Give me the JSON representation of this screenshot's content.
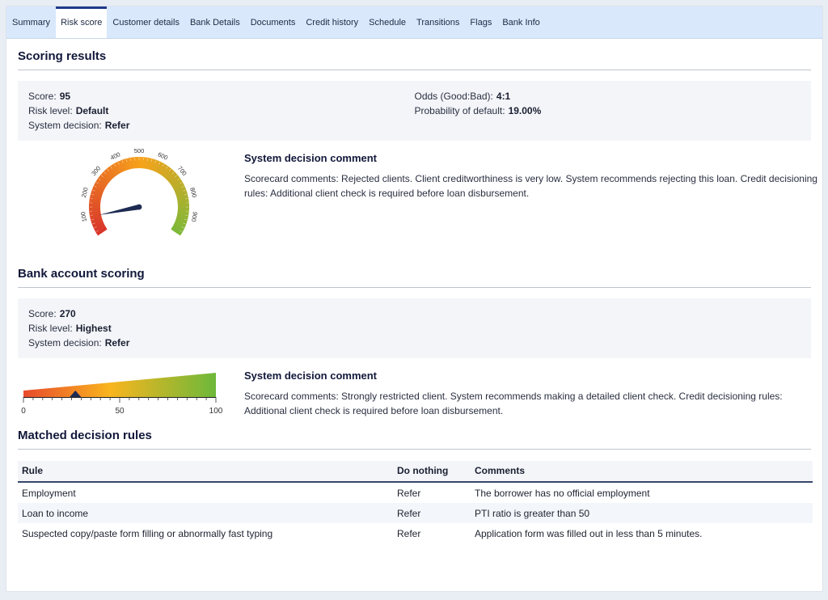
{
  "tabs": [
    {
      "label": "Summary",
      "active": false
    },
    {
      "label": "Risk score",
      "active": true
    },
    {
      "label": "Customer details",
      "active": false
    },
    {
      "label": "Bank Details",
      "active": false
    },
    {
      "label": "Documents",
      "active": false
    },
    {
      "label": "Credit history",
      "active": false
    },
    {
      "label": "Schedule",
      "active": false
    },
    {
      "label": "Transitions",
      "active": false
    },
    {
      "label": "Flags",
      "active": false
    },
    {
      "label": "Bank Info",
      "active": false
    }
  ],
  "scoring": {
    "title": "Scoring results",
    "score_label": "Score:",
    "score": "95",
    "risk_label": "Risk level:",
    "risk": "Default",
    "decision_label": "System decision:",
    "decision": "Refer",
    "odds_label": "Odds (Good:Bad):",
    "odds": "4:1",
    "pd_label": "Probability of default:",
    "pd": "19.00%",
    "gauge": {
      "min": 0,
      "max": 1000,
      "value": 95,
      "tick_labels": [
        "100",
        "200",
        "300",
        "400",
        "500",
        "600",
        "700",
        "800",
        "900"
      ],
      "colors": {
        "low": "#d9362b",
        "mid": "#f7a21b",
        "high": "#7ab93a",
        "needle": "#1d2a52"
      }
    },
    "comment_title": "System decision comment",
    "comment_text": "Scorecard comments: Rejected clients. Client creditworthiness is very low. System recommends rejecting this loan. Credit decisioning rules: Additional client check is required before loan disbursement."
  },
  "bank": {
    "title": "Bank account scoring",
    "score_label": "Score:",
    "score": "270",
    "risk_label": "Risk level:",
    "risk": "Highest",
    "decision_label": "System decision:",
    "decision": "Refer",
    "scale": {
      "min": 0,
      "max": 100,
      "marker": 27,
      "tick_labels": [
        "0",
        "50",
        "100"
      ],
      "colors": {
        "low": "#e84a2c",
        "mid": "#f9b51e",
        "high": "#6db83a",
        "marker": "#1d2a52"
      }
    },
    "comment_title": "System decision comment",
    "comment_text": "Scorecard comments: Strongly restricted client. System recommends making a detailed client check. Credit decisioning rules: Additional client check is required before loan disbursement."
  },
  "rules": {
    "title": "Matched decision rules",
    "columns": [
      "Rule",
      "Do nothing",
      "Comments"
    ],
    "rows": [
      [
        "Employment",
        "Refer",
        "The borrower has no official employment"
      ],
      [
        "Loan to income",
        "Refer",
        "PTI ratio is greater than 50"
      ],
      [
        "Suspected copy/paste form filling or abnormally fast typing",
        "Refer",
        "Application form was filled out in less than 5 minutes."
      ]
    ]
  }
}
